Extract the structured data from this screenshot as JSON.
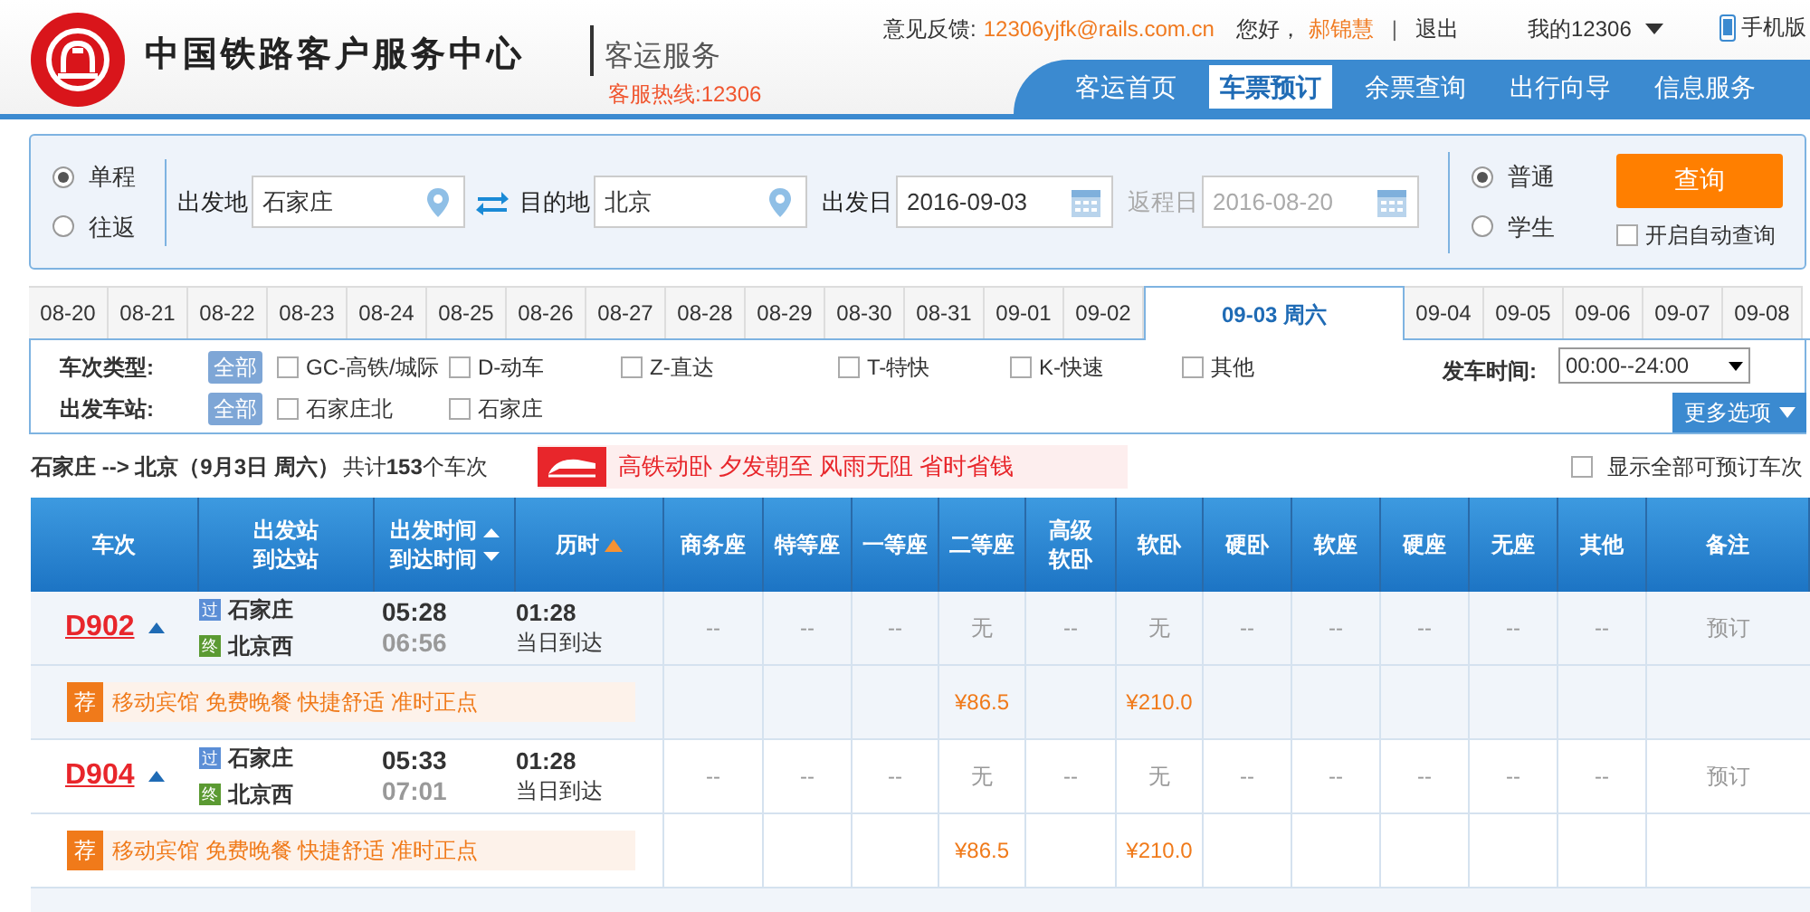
{
  "header": {
    "site_title": "中国铁路客户服务中心",
    "subtitle": "客运服务",
    "hotline": "客服热线:12306",
    "feedback_label": "意见反馈:",
    "feedback_email": "12306yjfk@rails.com.cn",
    "greeting": "您好，",
    "username": "郝锦慧",
    "separator": "|",
    "logout": "退出",
    "my_account": "我的12306",
    "mobile": "手机版",
    "nav": [
      {
        "label": "客运首页",
        "selected": false
      },
      {
        "label": "车票预订",
        "selected": true
      },
      {
        "label": "余票查询",
        "selected": false
      },
      {
        "label": "出行向导",
        "selected": false
      },
      {
        "label": "信息服务",
        "selected": false
      }
    ]
  },
  "search": {
    "trip_types": [
      {
        "label": "单程",
        "selected": true
      },
      {
        "label": "往返",
        "selected": false
      }
    ],
    "from_label": "出发地",
    "from_value": "石家庄",
    "to_label": "目的地",
    "to_value": "北京",
    "date_label": "出发日",
    "date_value": "2016-09-03",
    "return_label": "返程日",
    "return_value": "2016-08-20",
    "return_disabled": true,
    "passenger_types": [
      {
        "label": "普通",
        "selected": true
      },
      {
        "label": "学生",
        "selected": false
      }
    ],
    "query_button": "查询",
    "auto_query": {
      "label": "开启自动查询",
      "checked": false
    }
  },
  "dates": [
    {
      "label": "08-20",
      "selected": false
    },
    {
      "label": "08-21",
      "selected": false
    },
    {
      "label": "08-22",
      "selected": false
    },
    {
      "label": "08-23",
      "selected": false
    },
    {
      "label": "08-24",
      "selected": false
    },
    {
      "label": "08-25",
      "selected": false
    },
    {
      "label": "08-26",
      "selected": false
    },
    {
      "label": "08-27",
      "selected": false
    },
    {
      "label": "08-28",
      "selected": false
    },
    {
      "label": "08-29",
      "selected": false
    },
    {
      "label": "08-30",
      "selected": false
    },
    {
      "label": "08-31",
      "selected": false
    },
    {
      "label": "09-01",
      "selected": false
    },
    {
      "label": "09-02",
      "selected": false
    },
    {
      "label": "09-03 周六",
      "selected": true
    },
    {
      "label": "09-04",
      "selected": false
    },
    {
      "label": "09-05",
      "selected": false
    },
    {
      "label": "09-06",
      "selected": false
    },
    {
      "label": "09-07",
      "selected": false
    },
    {
      "label": "09-08",
      "selected": false
    }
  ],
  "filters": {
    "train_type_label": "车次类型:",
    "train_type_all": "全部",
    "train_types": [
      {
        "label": "GC-高铁/城际",
        "checked": false
      },
      {
        "label": "D-动车",
        "checked": false
      },
      {
        "label": "Z-直达",
        "checked": false
      },
      {
        "label": "T-特快",
        "checked": false
      },
      {
        "label": "K-快速",
        "checked": false
      },
      {
        "label": "其他",
        "checked": false
      }
    ],
    "station_label": "出发车站:",
    "station_all": "全部",
    "stations": [
      {
        "label": "石家庄北",
        "checked": false
      },
      {
        "label": "石家庄",
        "checked": false
      }
    ],
    "time_label": "发车时间:",
    "time_value": "00:00--24:00",
    "more_button": "更多选项"
  },
  "summary": {
    "route": "石家庄 --> 北京（9月3日  周六）",
    "count": "共计**153**个车次",
    "banner": "高铁动卧 夕发朝至 风雨无阻 省时省钱",
    "show_all": {
      "label": "显示全部可预订车次",
      "checked": false
    }
  },
  "table": {
    "columns": [
      {
        "lines": [
          "车次"
        ],
        "sortable": false
      },
      {
        "lines": [
          "出发站",
          "到达站"
        ],
        "sortable": false
      },
      {
        "lines": [
          "出发时间",
          "到达时间"
        ],
        "sortable": true,
        "sort_active": false
      },
      {
        "lines": [
          "历时"
        ],
        "sortable": true,
        "sort_active": true
      },
      {
        "lines": [
          "商务座"
        ],
        "sortable": false
      },
      {
        "lines": [
          "特等座"
        ],
        "sortable": false
      },
      {
        "lines": [
          "一等座"
        ],
        "sortable": false
      },
      {
        "lines": [
          "二等座"
        ],
        "sortable": false
      },
      {
        "lines": [
          "高级",
          "软卧"
        ],
        "sortable": false
      },
      {
        "lines": [
          "软卧"
        ],
        "sortable": false
      },
      {
        "lines": [
          "硬卧"
        ],
        "sortable": false
      },
      {
        "lines": [
          "软座"
        ],
        "sortable": false
      },
      {
        "lines": [
          "硬座"
        ],
        "sortable": false
      },
      {
        "lines": [
          "无座"
        ],
        "sortable": false
      },
      {
        "lines": [
          "其他"
        ],
        "sortable": false
      },
      {
        "lines": [
          "备注"
        ],
        "sortable": false
      }
    ],
    "rows": [
      {
        "kind": "train",
        "train": "D902",
        "from_badge": "过",
        "from_station": "石家庄",
        "to_badge": "终",
        "to_station": "北京西",
        "depart": "05:28",
        "arrive": "06:56",
        "duration": "01:28",
        "arrival_day": "当日到达",
        "seats": [
          "--",
          "--",
          "--",
          "无",
          "--",
          "无",
          "--",
          "--",
          "--",
          "--",
          "--"
        ],
        "action": "预订"
      },
      {
        "kind": "promo",
        "tag": "荐",
        "text": "移动宾馆 免费晚餐 快捷舒适 准时正点",
        "prices": [
          {
            "kind": "blank"
          },
          {
            "kind": "blank"
          },
          {
            "kind": "blank"
          },
          {
            "kind": "price",
            "text": "¥86.5"
          },
          {
            "kind": "blank"
          },
          {
            "kind": "price",
            "text": "¥210.0"
          },
          {
            "kind": "blank"
          },
          {
            "kind": "blank"
          },
          {
            "kind": "blank"
          },
          {
            "kind": "blank"
          },
          {
            "kind": "blank"
          }
        ]
      },
      {
        "kind": "train",
        "train": "D904",
        "from_badge": "过",
        "from_station": "石家庄",
        "to_badge": "终",
        "to_station": "北京西",
        "depart": "05:33",
        "arrive": "07:01",
        "duration": "01:28",
        "arrival_day": "当日到达",
        "seats": [
          "--",
          "--",
          "--",
          "无",
          "--",
          "无",
          "--",
          "--",
          "--",
          "--",
          "--"
        ],
        "action": "预订"
      },
      {
        "kind": "promo",
        "tag": "荐",
        "text": "移动宾馆 免费晚餐 快捷舒适 准时正点",
        "prices": [
          {
            "kind": "blank"
          },
          {
            "kind": "blank"
          },
          {
            "kind": "blank"
          },
          {
            "kind": "price",
            "text": "¥86.5"
          },
          {
            "kind": "blank"
          },
          {
            "kind": "price",
            "text": "¥210.0"
          },
          {
            "kind": "blank"
          },
          {
            "kind": "blank"
          },
          {
            "kind": "blank"
          },
          {
            "kind": "blank"
          },
          {
            "kind": "blank"
          }
        ]
      },
      {
        "kind": "cut"
      }
    ]
  }
}
